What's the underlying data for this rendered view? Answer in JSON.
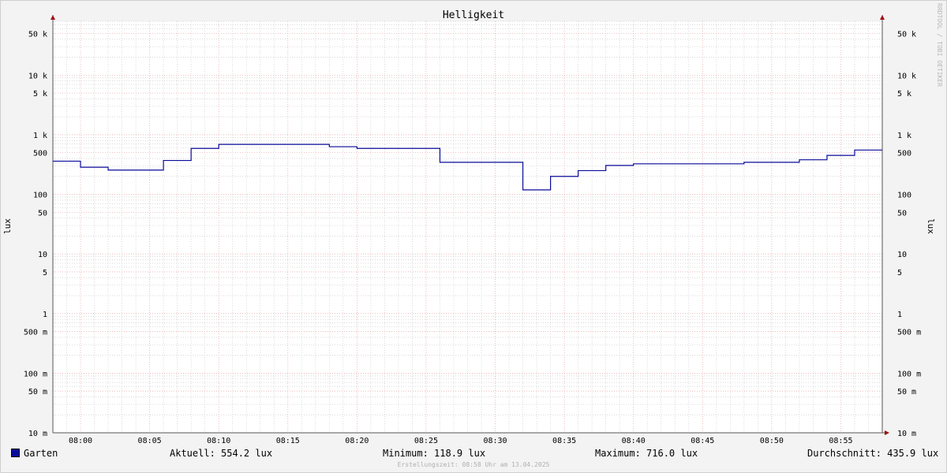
{
  "chart_data": {
    "type": "line",
    "title": "Helligkeit",
    "ylabel": "lux",
    "yscale": "log",
    "ylim": [
      0.01,
      80000
    ],
    "xlim": [
      "07:58",
      "08:58"
    ],
    "x_tick_labels": [
      "08:00",
      "08:05",
      "08:10",
      "08:15",
      "08:20",
      "08:25",
      "08:30",
      "08:35",
      "08:40",
      "08:45",
      "08:50",
      "08:55"
    ],
    "y_tick_labels": [
      {
        "value": 50000,
        "label": "50 k"
      },
      {
        "value": 10000,
        "label": "10 k"
      },
      {
        "value": 5000,
        "label": "5 k"
      },
      {
        "value": 1000,
        "label": "1 k"
      },
      {
        "value": 500,
        "label": "500"
      },
      {
        "value": 100,
        "label": "100"
      },
      {
        "value": 50,
        "label": "50"
      },
      {
        "value": 10,
        "label": "10"
      },
      {
        "value": 5,
        "label": "5"
      },
      {
        "value": 1,
        "label": "1"
      },
      {
        "value": 0.5,
        "label": "500 m"
      },
      {
        "value": 0.1,
        "label": "100 m"
      },
      {
        "value": 0.05,
        "label": "50 m"
      },
      {
        "value": 0.01,
        "label": "10 m"
      }
    ],
    "series": [
      {
        "name": "Garten",
        "color": "#0a0a9a",
        "points": [
          {
            "t": "07:58",
            "v": 360
          },
          {
            "t": "08:00",
            "v": 285
          },
          {
            "t": "08:02",
            "v": 255
          },
          {
            "t": "08:06",
            "v": 370
          },
          {
            "t": "08:08",
            "v": 590
          },
          {
            "t": "08:10",
            "v": 690
          },
          {
            "t": "08:18",
            "v": 630
          },
          {
            "t": "08:20",
            "v": 590
          },
          {
            "t": "08:26",
            "v": 345
          },
          {
            "t": "08:32",
            "v": 118.9
          },
          {
            "t": "08:34",
            "v": 200
          },
          {
            "t": "08:36",
            "v": 250
          },
          {
            "t": "08:38",
            "v": 305
          },
          {
            "t": "08:40",
            "v": 325
          },
          {
            "t": "08:48",
            "v": 345
          },
          {
            "t": "08:52",
            "v": 380
          },
          {
            "t": "08:54",
            "v": 450
          },
          {
            "t": "08:56",
            "v": 554.2
          }
        ]
      }
    ],
    "grid": true
  },
  "legend": {
    "series_name": "Garten",
    "current": "Aktuell: 554.2 lux",
    "minimum": "Minimum: 118.9 lux",
    "maximum": "Maximum: 716.0 lux",
    "average": "Durchschnitt: 435.9 lux"
  },
  "watermark": "RRDTOOL / TOBI OETIKER",
  "footer": "Erstellungszeit: 08:58 Uhr am 13.04.2025",
  "colors": {
    "major_grid": "#e8a0a0",
    "minor_grid": "#cccccc",
    "series": "#0a0a9a",
    "axis": "#555555",
    "arrow": "#a01010"
  }
}
